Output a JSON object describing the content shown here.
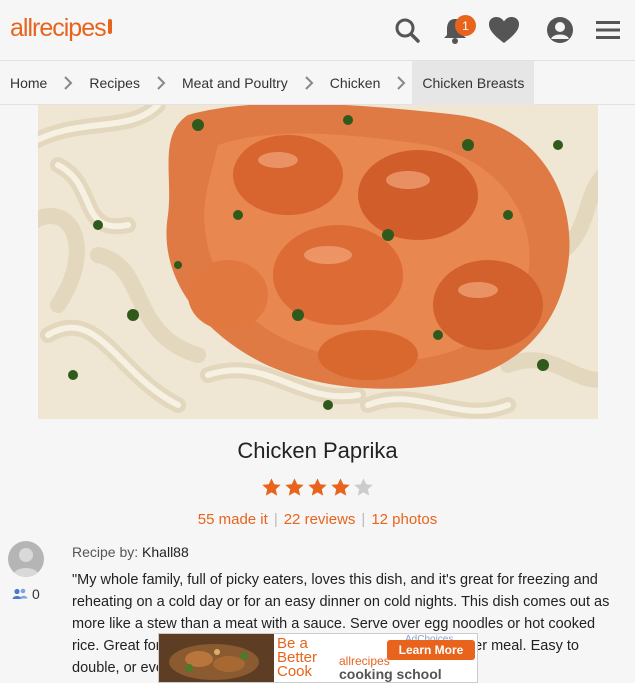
{
  "header": {
    "logo": "allrecipes",
    "notification_count": "1",
    "icons": [
      "search-icon",
      "bell-icon",
      "heart-icon",
      "profile-icon",
      "menu-icon"
    ]
  },
  "breadcrumb": [
    "Home",
    "Recipes",
    "Meat and Poultry",
    "Chicken",
    "Chicken Breasts"
  ],
  "recipe": {
    "title": "Chicken Paprika",
    "rating": 4,
    "rating_max": 5,
    "made_it": "55 made it",
    "reviews": "22 reviews",
    "photos": "12 photos",
    "recipe_by_label": "Recipe by:",
    "author": "Khall88",
    "followers": "0",
    "description": "\"My whole family, full of picky eaters, loves this dish, and it's great for freezing and reheating on a cold day or for an easy dinner on cold nights. This dish comes out as more like a stew than a meat with a sauce. Serve over egg noodles or hot cooked rice. Great for a casual dinner, and great served for hearty winter meal. Easy to double, or even triple, this dish, for lengthy parties.\""
  },
  "ad": {
    "headline": "Be a Better Cook",
    "brand": "allrecipes",
    "sub": "cooking school",
    "button": "Learn More",
    "adchoices": "AdChoices"
  },
  "colors": {
    "accent": "#e8641d",
    "star_empty": "#cccccc"
  }
}
